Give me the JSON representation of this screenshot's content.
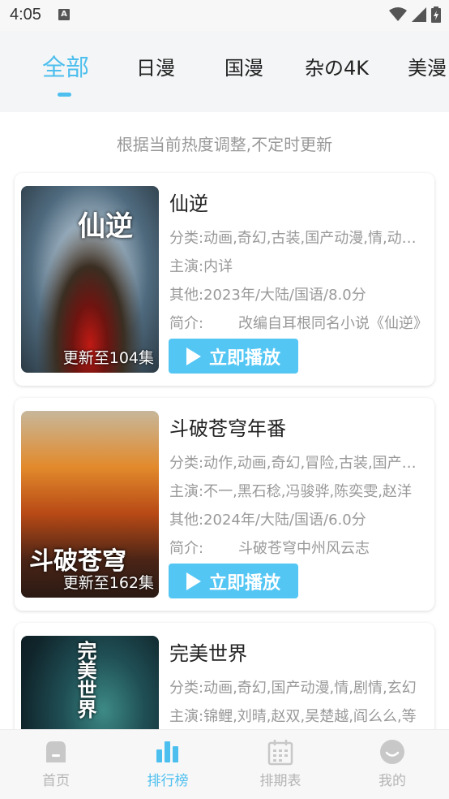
{
  "status": {
    "time": "4:05",
    "a_badge": "A"
  },
  "tabs": [
    {
      "label": "全部",
      "active": true
    },
    {
      "label": "日漫",
      "active": false
    },
    {
      "label": "国漫",
      "active": false
    },
    {
      "label": "杂の4K",
      "active": false
    },
    {
      "label": "美漫",
      "active": false
    }
  ],
  "notice": "根据当前热度调整,不定时更新",
  "play_label": "立即播放",
  "cards": [
    {
      "title": "仙逆",
      "badge": "更新至104集",
      "poster_text": "仙逆",
      "category": "分类:动画,奇幻,古装,国产动漫,情,动作,冒险",
      "cast": "主演:内详",
      "other": "其他:2023年/大陆/国语/8.0分",
      "intro_label": "简介:",
      "intro": "改编自耳根同名小说《仙逆》"
    },
    {
      "title": "斗破苍穹年番",
      "badge": "更新至162集",
      "poster_text": "斗破苍穹",
      "category": "分类:动作,动画,奇幻,冒险,古装,国产动漫",
      "cast": "主演:不一,黑石稔,冯骏骅,陈奕雯,赵洋",
      "other": "其他:2024年/大陆/国语/6.0分",
      "intro_label": "简介:",
      "intro": "斗破苍穹中州风云志"
    },
    {
      "title": "完美世界",
      "badge": "",
      "poster_text": "完美世界",
      "category": "分类:动画,奇幻,国产动漫,情,剧情,玄幻",
      "cast": "主演:锦鲤,刘晴,赵双,吴楚越,阎么么,等"
    }
  ],
  "nav": [
    {
      "label": "首页",
      "icon": "home-icon",
      "active": false
    },
    {
      "label": "排行榜",
      "icon": "ranking-icon",
      "active": true
    },
    {
      "label": "排期表",
      "icon": "calendar-icon",
      "active": false
    },
    {
      "label": "我的",
      "icon": "profile-icon",
      "active": false
    }
  ],
  "colors": {
    "accent": "#4dbfee",
    "button": "#54c6f4",
    "muted": "#999999"
  }
}
